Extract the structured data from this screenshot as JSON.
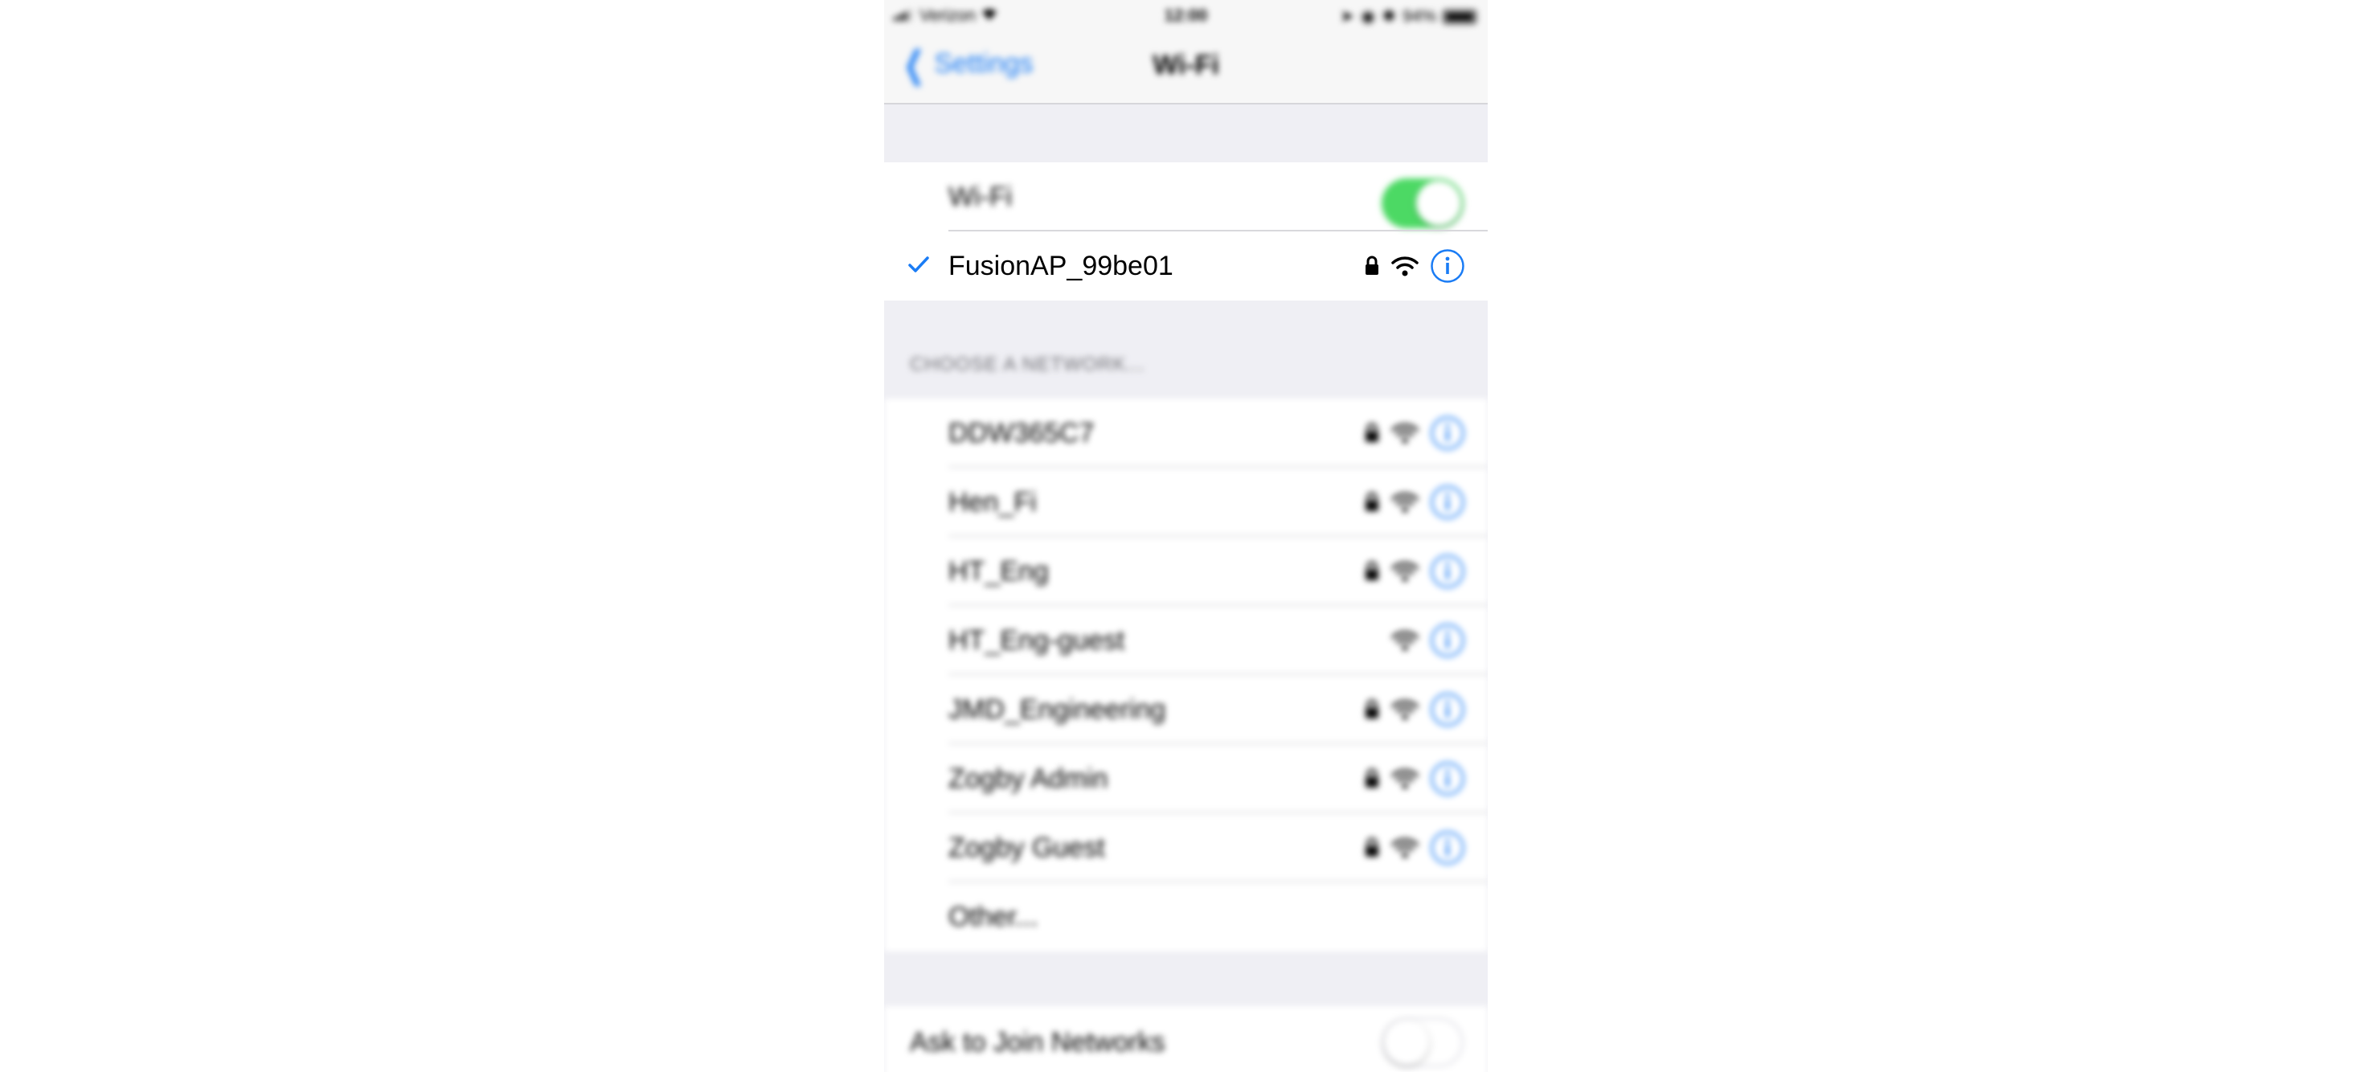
{
  "status_bar": {
    "carrier": "Verizon",
    "time": "12:00",
    "battery": "94%"
  },
  "nav": {
    "back_label": "Settings",
    "title": "Wi-Fi"
  },
  "wifi_toggle": {
    "label": "Wi-Fi",
    "state": "on"
  },
  "connected_network": {
    "name": "FusionAP_99be01",
    "secured": true,
    "icon": "checkmark-icon"
  },
  "section_header": "CHOOSE A NETWORK...",
  "networks": [
    {
      "name": "DDW365C7",
      "secured": true
    },
    {
      "name": "Hen_Fi",
      "secured": true
    },
    {
      "name": "HT_Eng",
      "secured": true
    },
    {
      "name": "HT_Eng-guest",
      "secured": false
    },
    {
      "name": "JMD_Engineering",
      "secured": true
    },
    {
      "name": "Zogby Admin",
      "secured": true
    },
    {
      "name": "Zogby Guest",
      "secured": true
    }
  ],
  "other_label": "Other...",
  "ask_to_join": {
    "label": "Ask to Join Networks",
    "state": "off"
  },
  "colors": {
    "accent": "#1a7cf5",
    "toggle_on": "#4cd964",
    "grouped_bg": "#efeff4"
  }
}
